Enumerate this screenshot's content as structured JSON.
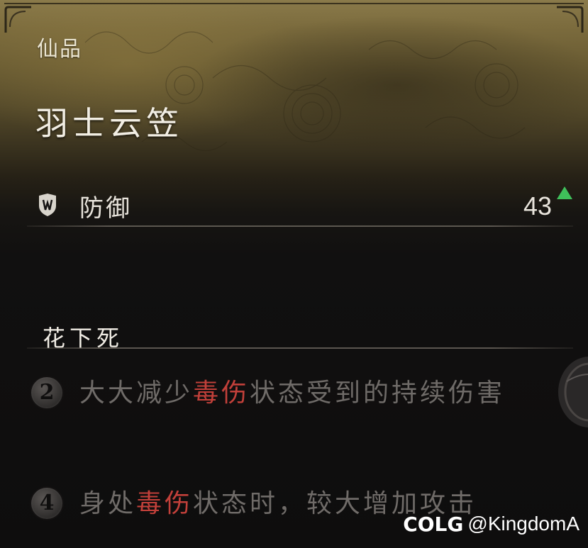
{
  "item": {
    "rarity": "仙品",
    "name": "羽士云笠"
  },
  "stat": {
    "icon": "shield-icon",
    "label": "防御",
    "value": "43",
    "trend_icon": "up-arrow-icon",
    "trend_color": "#3fbf5a"
  },
  "set": {
    "name": "花下死",
    "bonuses": [
      {
        "pieces": "2",
        "text_before": "大大减少",
        "highlight": "毒伤",
        "text_after": "状态受到的持续伤害"
      },
      {
        "pieces": "4",
        "text_before": "身处",
        "highlight": "毒伤",
        "text_after": "状态时，较大增加攻击"
      }
    ]
  },
  "colors": {
    "highlight": "#c2403a",
    "muted_text": "#6f6b68",
    "title_text": "#f2eee4"
  },
  "watermark": {
    "logo": "COLG",
    "handle": "@KingdomA"
  }
}
